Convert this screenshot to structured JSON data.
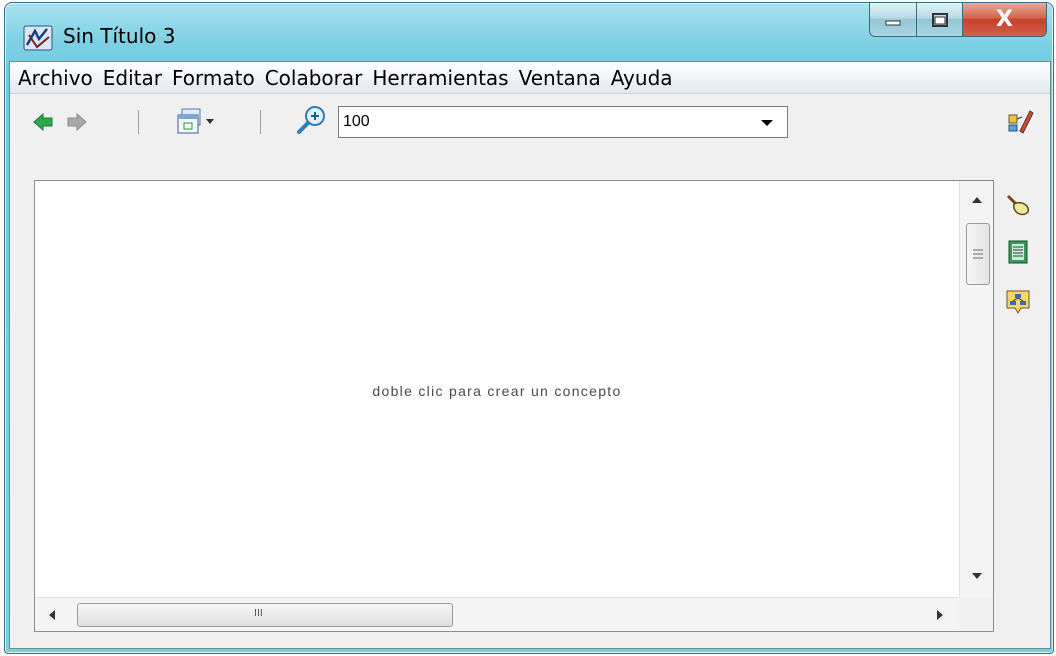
{
  "window": {
    "title": "Sin Título 3",
    "close_glyph": "X"
  },
  "menubar": {
    "items": [
      "Archivo",
      "Editar",
      "Formato",
      "Colaborar",
      "Herramientas",
      "Ventana",
      "Ayuda"
    ]
  },
  "toolbar": {
    "zoom_value": "100",
    "icons": [
      "back-arrow-icon",
      "forward-arrow-icon",
      "windows-dropdown-icon",
      "zoom-icon",
      "edit-tools-icon"
    ]
  },
  "canvas": {
    "hint": "doble clic para crear un concepto",
    "hscroll_grip": "III"
  },
  "sidebar": {
    "icons": [
      "styles-brush-icon",
      "document-list-icon",
      "concept-map-icon"
    ]
  },
  "colors": {
    "titlebar": "#78cfe2",
    "close_button": "#c7402a",
    "back_arrow": "#2aa84a",
    "forward_arrow": "#a8a8a8"
  }
}
